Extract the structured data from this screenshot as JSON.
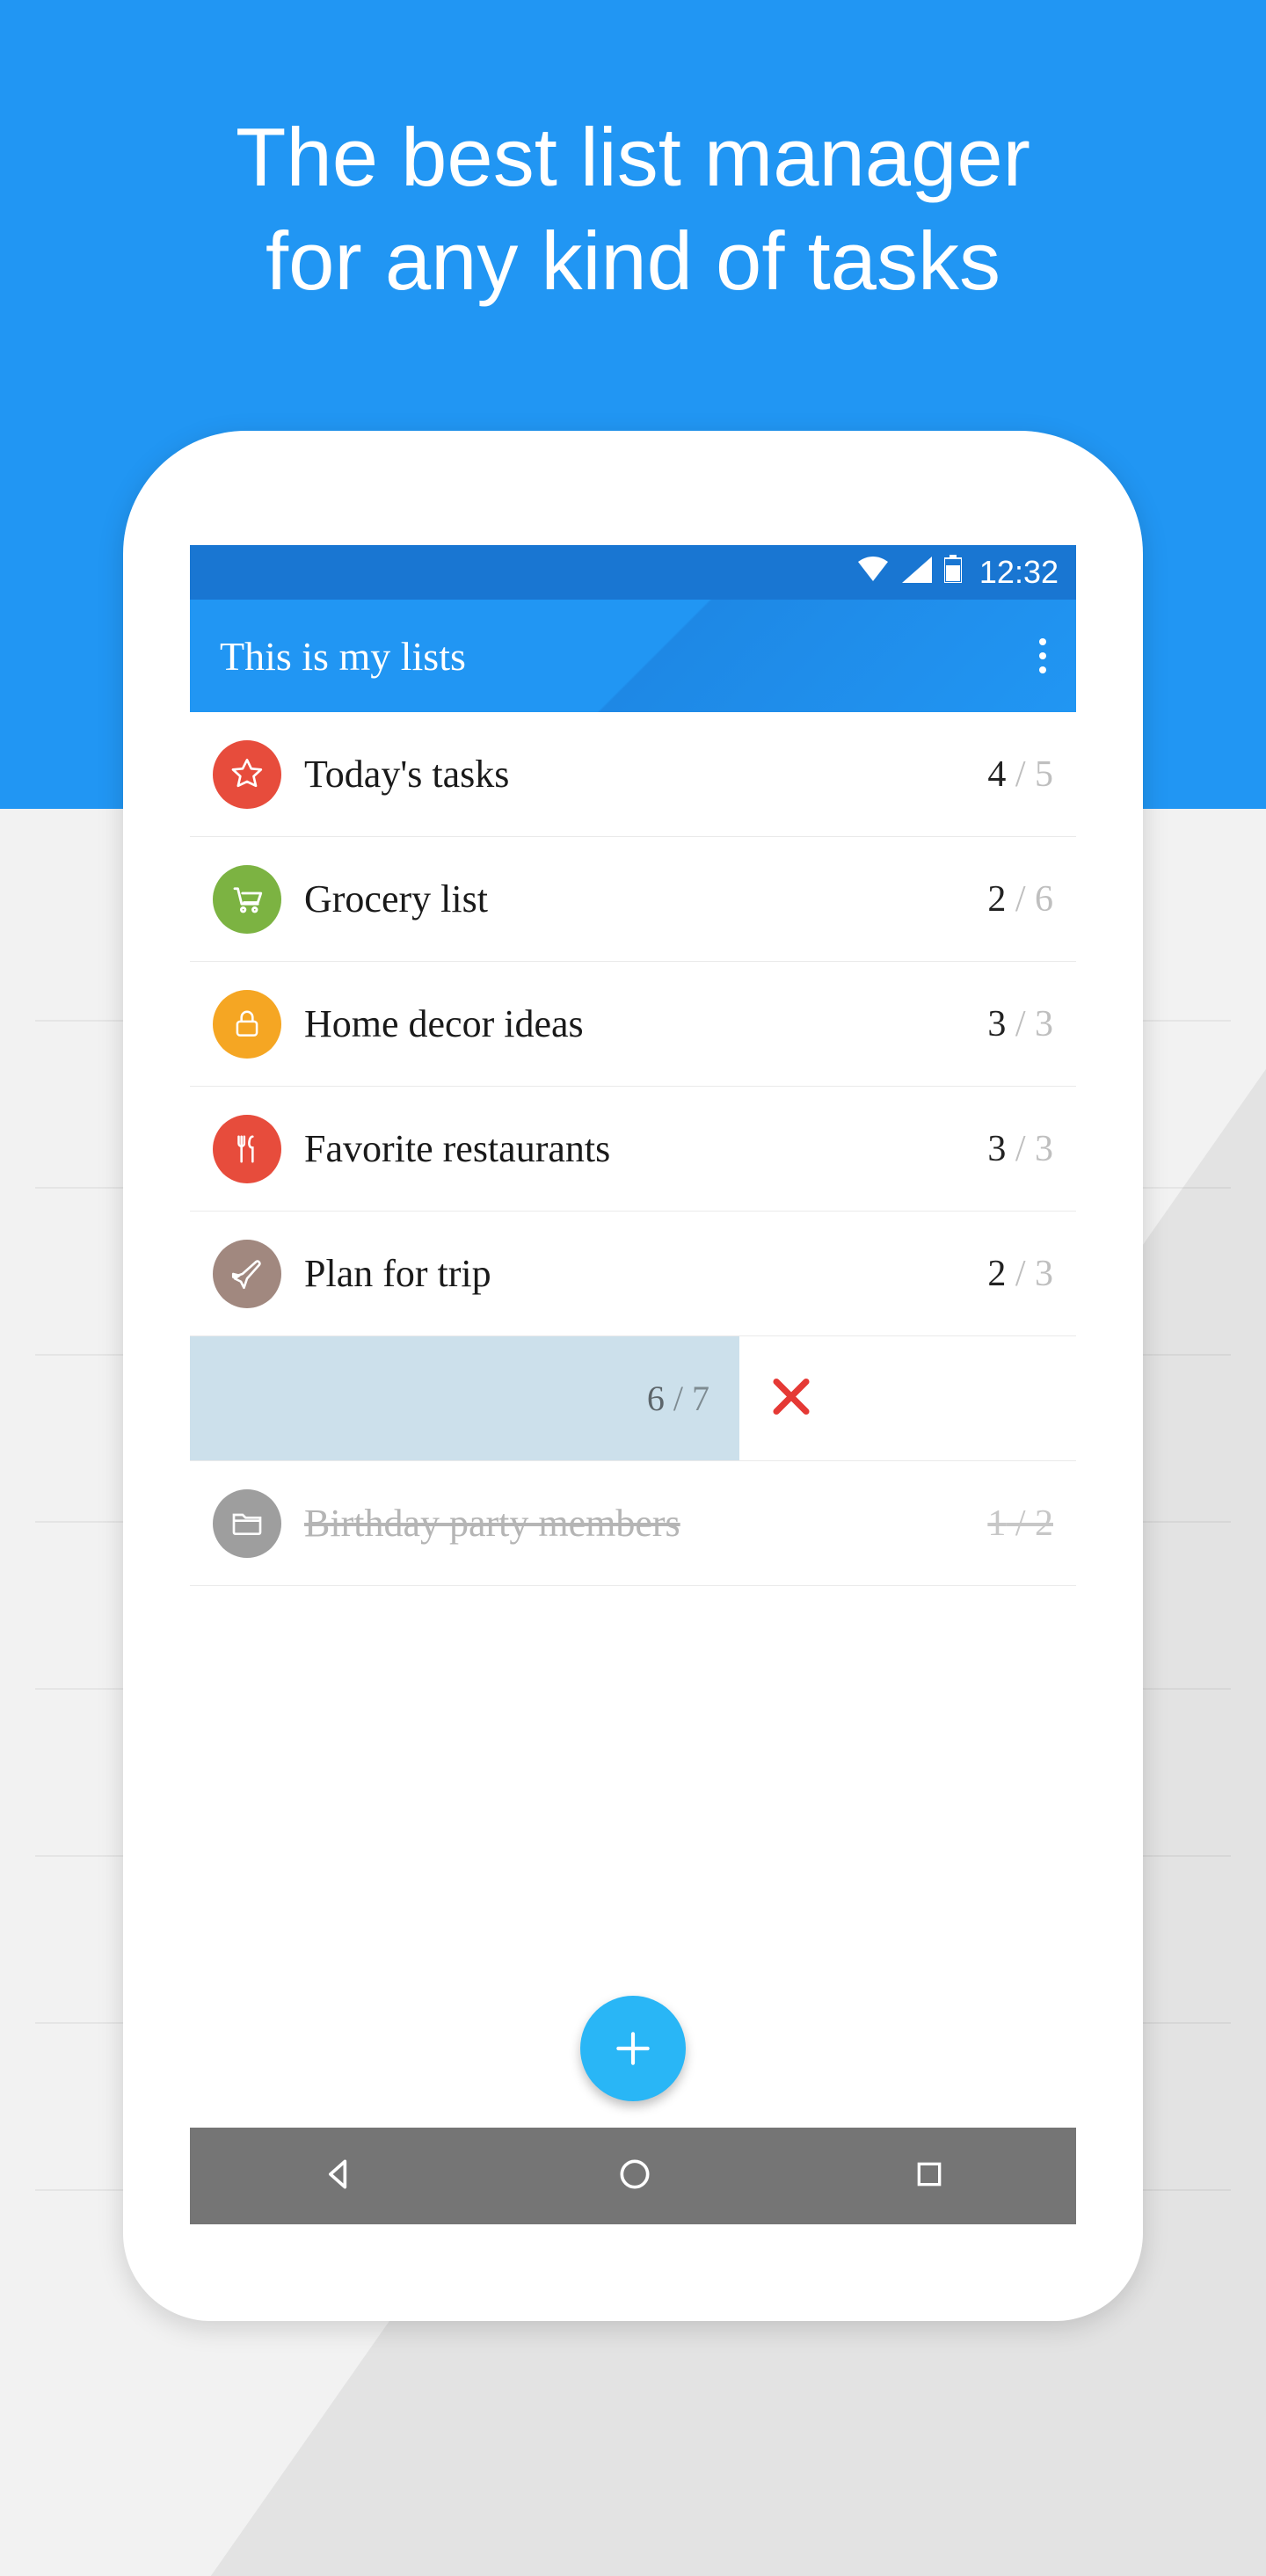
{
  "headline_line1": "The best list manager",
  "headline_line2": "for any kind of tasks",
  "statusbar": {
    "time": "12:32"
  },
  "appbar": {
    "title": "This is my lists"
  },
  "lists": [
    {
      "icon": "star",
      "color": "#e74c3c",
      "title": "Today's tasks",
      "done": "4",
      "total": "5"
    },
    {
      "icon": "cart",
      "color": "#7cb342",
      "title": "Grocery list",
      "done": "2",
      "total": "6"
    },
    {
      "icon": "lock",
      "color": "#f5a623",
      "title": "Home decor ideas",
      "done": "3",
      "total": "3"
    },
    {
      "icon": "food",
      "color": "#e74c3c",
      "title": "Favorite restaurants",
      "done": "3",
      "total": "3"
    },
    {
      "icon": "plane",
      "color": "#a1887f",
      "title": "Plan for trip",
      "done": "2",
      "total": "3"
    }
  ],
  "swipe": {
    "done": "6",
    "total": "7"
  },
  "completed": {
    "icon": "folder",
    "color": "#9e9e9e",
    "title": "Birthday party members",
    "done": "1",
    "total": "2"
  }
}
